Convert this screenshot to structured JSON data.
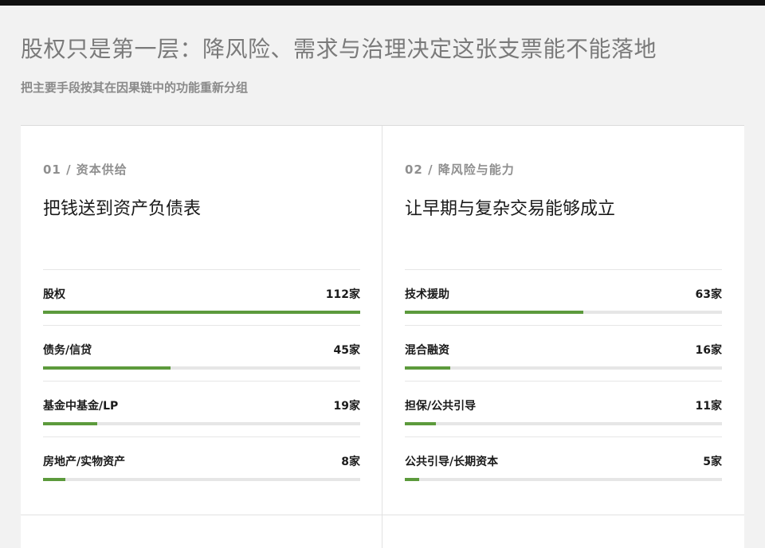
{
  "page": {
    "title": "股权只是第一层：降风险、需求与治理决定这张支票能不能落地",
    "subtitle": "把主要手段按其在因果链中的功能重新分组"
  },
  "colors": {
    "accent": "#5c9a3c",
    "track": "#e6e6e6",
    "background": "#f2f2f2",
    "topbar": "#111111"
  },
  "chart_data": [
    {
      "type": "bar",
      "eyebrow": "01 / 资本供给",
      "title": "把钱送到资产负债表",
      "max": 112,
      "unit": "家",
      "categories": [
        "股权",
        "债务/信贷",
        "基金中基金/LP",
        "房地产/实物资产"
      ],
      "values": [
        112,
        45,
        19,
        8
      ]
    },
    {
      "type": "bar",
      "eyebrow": "02 / 降风险与能力",
      "title": "让早期与复杂交易能够成立",
      "max": 112,
      "unit": "家",
      "categories": [
        "技术援助",
        "混合融资",
        "担保/公共引导",
        "公共引导/长期资本"
      ],
      "values": [
        63,
        16,
        11,
        5
      ]
    }
  ]
}
